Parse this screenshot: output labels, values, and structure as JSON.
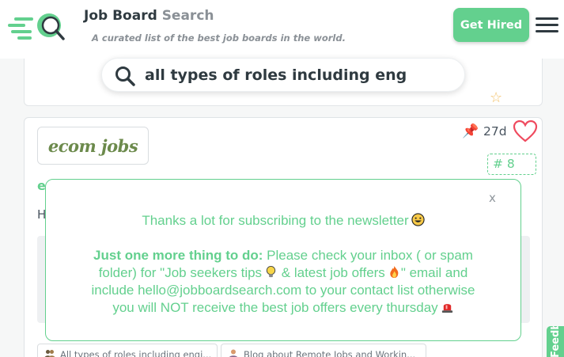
{
  "header": {
    "brand_main": "Job Board",
    "brand_accent": "Search",
    "tagline": "A curated list of the best job boards in the world.",
    "cta_label": "Get Hired",
    "menu_icon": "hamburger-icon",
    "logo_icon": "magnifier-speed-icon"
  },
  "search": {
    "icon": "search-icon",
    "value": "all types of roles including eng"
  },
  "previous_card": {
    "star_icon": "star-icon"
  },
  "job_card": {
    "logo_text": "ecom jobs",
    "age": "27d",
    "pin_icon": "pushpin-icon",
    "heart_icon": "heart-icon",
    "rank": "# 8",
    "title_peek": "e",
    "body_peek": "H",
    "tags": [
      {
        "icon": "people-icon",
        "label": "All types of roles including engi..."
      },
      {
        "icon": "person-icon",
        "label": "Blog about Remote Jobs and Workin..."
      }
    ]
  },
  "modal": {
    "close_label": "x",
    "line1": "Thanks a lot for subscribing to the newsletter",
    "line2_bold": "Just one more thing to do:",
    "line2_rest": " Please check your inbox ( or spam",
    "line3_a": "folder) for \"Job seekers tips",
    "line3_b": " & latest job offers",
    "line3_c": "\" email and",
    "line4": "include hello@jobboardsearch.com to your contact list otherwise",
    "line5": "you will NOT receive the best job offers every thursday",
    "icons": [
      "grinning-face-icon",
      "lightbulb-icon",
      "fire-icon",
      "siren-icon"
    ]
  },
  "feedback": {
    "label": "Feedback"
  },
  "colors": {
    "accent_green": "#63d08e",
    "text_dark": "#2f3a40",
    "text_muted": "#8a9096"
  }
}
